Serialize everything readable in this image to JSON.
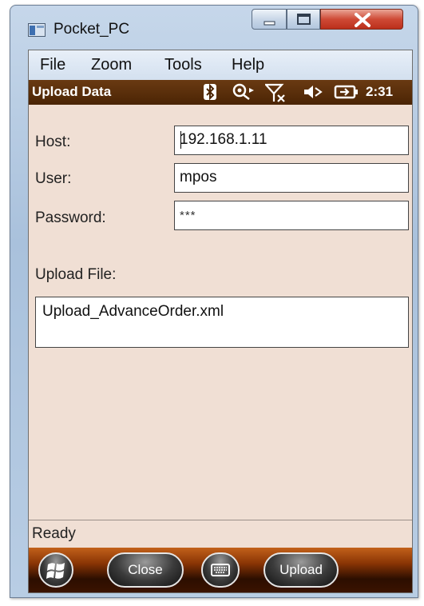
{
  "window": {
    "title": "Pocket_PC"
  },
  "menu": {
    "items": [
      "File",
      "Zoom",
      "Tools",
      "Help"
    ]
  },
  "status_strip": {
    "title": "Upload Data",
    "time": "2:31",
    "icons": [
      "bluetooth-icon",
      "connectivity-icon",
      "signal-off-icon",
      "volume-muted-icon",
      "battery-icon"
    ]
  },
  "form": {
    "host_label": "Host:",
    "host_value": "192.168.1.11",
    "user_label": "User:",
    "user_value": "mpos",
    "password_label": "Password:",
    "password_value": "***",
    "upload_file_label": "Upload File:",
    "upload_file_value": "Upload_AdvanceOrder.xml"
  },
  "status": {
    "text": "Ready"
  },
  "softkeys": {
    "close_label": "Close",
    "upload_label": "Upload"
  },
  "colors": {
    "client_background": "#f0dfd4",
    "status_strip": "#5a2e0a",
    "softbar": "#8a3505"
  }
}
